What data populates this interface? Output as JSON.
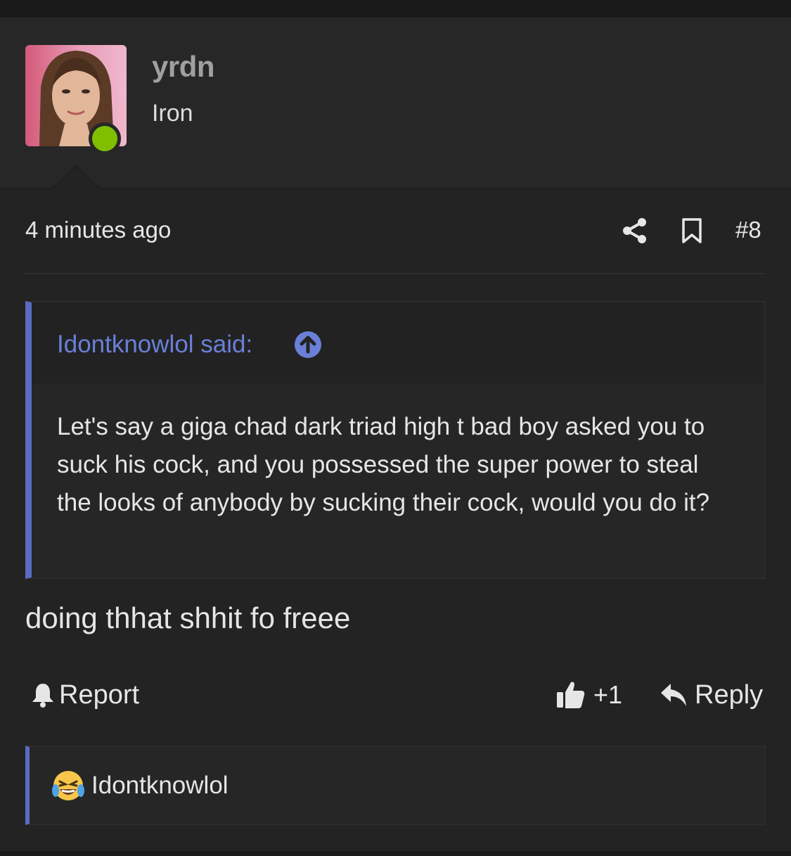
{
  "post": {
    "author": {
      "avatar_icon": "user-avatar-photo",
      "username": "yrdn",
      "rank": "Iron",
      "online": true,
      "online_color": "#7fbf00"
    },
    "timestamp": "4 minutes ago",
    "actions": {
      "share_icon": "share-icon",
      "bookmark_icon": "bookmark-icon",
      "post_number": "#8"
    },
    "quote": {
      "author_label": "Idontknowlol said:",
      "jump_icon": "arrow-up-circle-icon",
      "text": "Let's say a giga chad dark triad high t bad boy asked you to suck his cock, and you possessed the super power to steal the looks of anybody by sucking their cock, would you do it?",
      "accent_color": "#5a6bc2"
    },
    "message": "doing thhat shhit fo freee",
    "footer": {
      "report_label": "Report",
      "like_label": "+1",
      "reply_label": "Reply"
    },
    "reactions": [
      {
        "icon": "crying-laughing-emoji-icon",
        "user": "Idontknowlol"
      }
    ]
  }
}
